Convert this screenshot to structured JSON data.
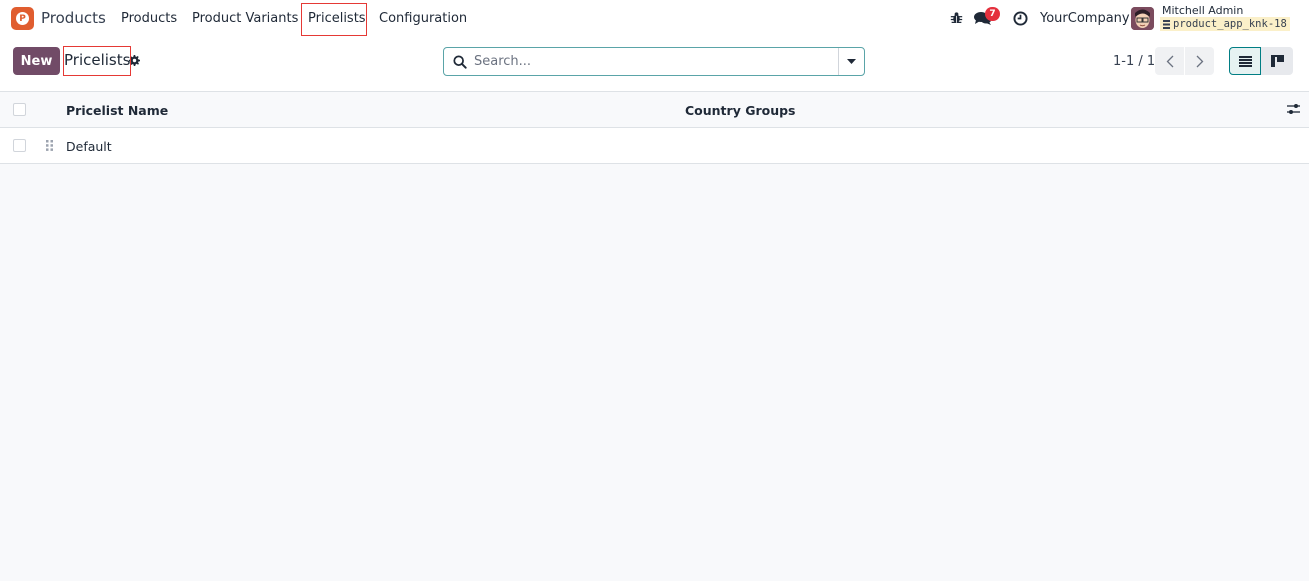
{
  "navbar": {
    "app_icon": "products-app-icon",
    "app_name": "Products",
    "menu": [
      {
        "label": "Products"
      },
      {
        "label": "Product Variants"
      },
      {
        "label": "Pricelists",
        "highlighted": true
      },
      {
        "label": "Configuration"
      }
    ],
    "systray": {
      "debug_icon": "bug-icon",
      "messages_icon": "chat-icon",
      "messages_badge": "7",
      "activity_icon": "clock-icon",
      "company": "YourCompany",
      "user_name": "Mitchell Admin",
      "database": "product_app_knk-18"
    },
    "colors": {
      "badge": "#e4303d",
      "app_icon": "#e05d2f"
    }
  },
  "control_panel": {
    "new_label": "New",
    "title": "Pricelists",
    "settings_icon": "gear-icon",
    "search": {
      "placeholder": "Search...",
      "value": ""
    },
    "pager": {
      "value": "1-1 / 1"
    },
    "views": [
      {
        "name": "list",
        "active": true
      },
      {
        "name": "kanban",
        "active": false
      }
    ],
    "colors": {
      "primary": "#714b67",
      "accent": "#017e84"
    }
  },
  "list": {
    "columns": [
      {
        "label": "Pricelist Name"
      },
      {
        "label": "Country Groups"
      }
    ],
    "rows": [
      {
        "name": "Default",
        "country_groups": ""
      }
    ]
  }
}
